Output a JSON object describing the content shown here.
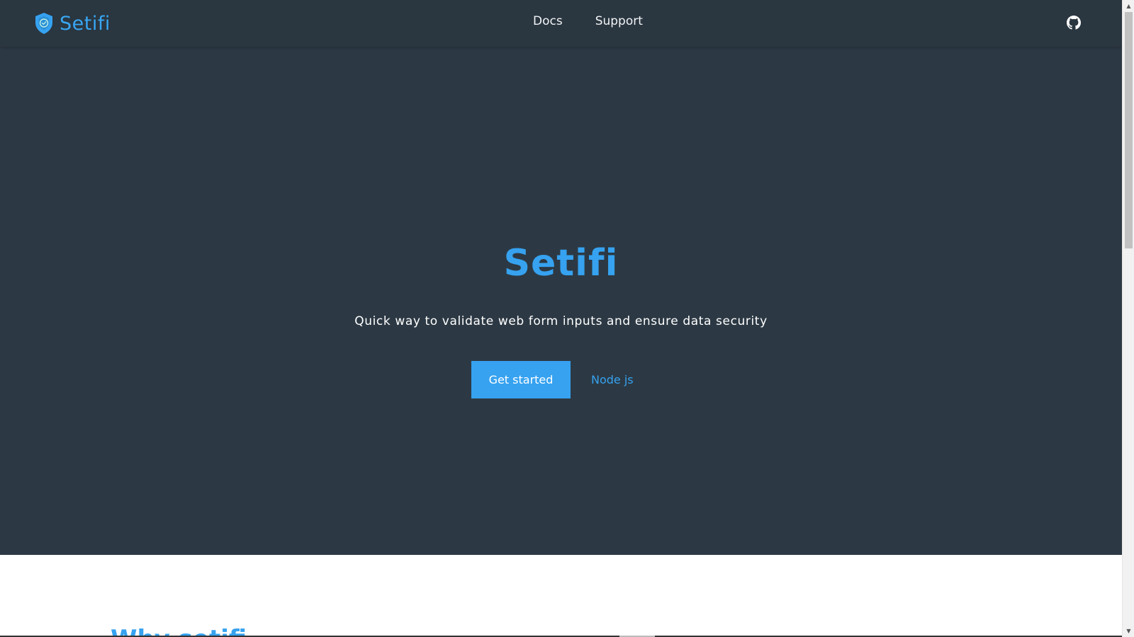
{
  "header": {
    "brand_name": "Setifi",
    "nav_links": [
      "Docs",
      "Support"
    ],
    "github_icon": "github-icon",
    "brand_icon": "shield-check-icon"
  },
  "hero": {
    "title": "Setifi",
    "subtitle": "Quick way to validate web form inputs and ensure data security",
    "primary_button": "Get started",
    "secondary_link": "Node js"
  },
  "next_section": {
    "heading_partial": "Why setifi"
  },
  "colors": {
    "accent": "#36a2f0",
    "navbar_bg": "#2a3640",
    "hero_bg": "#2c3944",
    "progress_accent": "#7b3fe4"
  },
  "scrollbar": {
    "up_icon": "scroll-up-arrow-icon",
    "down_icon": "scroll-down-arrow-icon"
  }
}
